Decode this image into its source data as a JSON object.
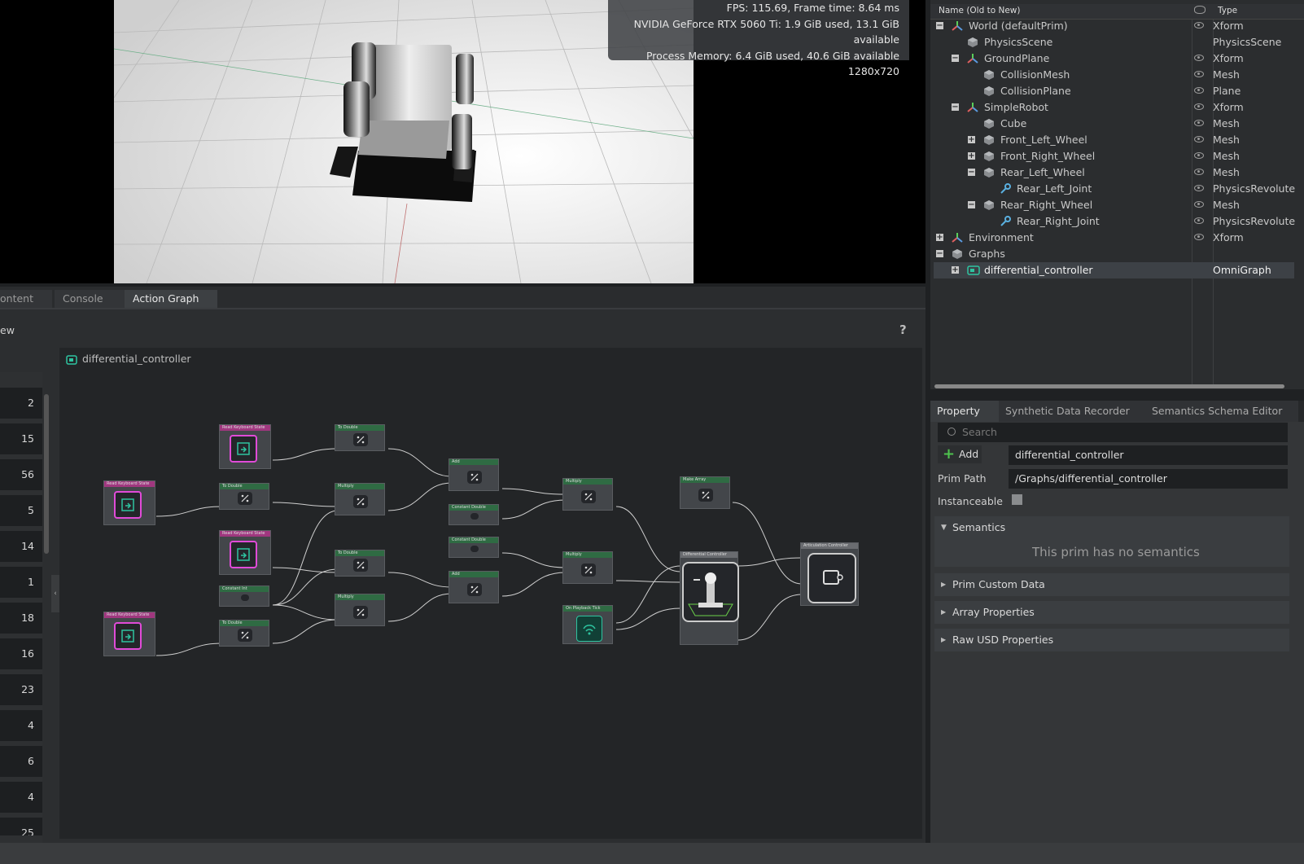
{
  "viewport": {
    "stats": [
      "FPS: 115.69, Frame time: 8.64 ms",
      "NVIDIA GeForce RTX 5060 Ti: 1.9 GiB used, 13.1 GiB available",
      "Process Memory: 6.4 GiB used, 40.6 GiB available",
      "1280x720"
    ]
  },
  "bottom_tabs": [
    "ontent",
    "Console",
    "Action Graph"
  ],
  "action_graph": {
    "header_left": "ew",
    "help_icon": "?",
    "graph_title": "differential_controller",
    "left_numbers": [
      "2",
      "15",
      "56",
      "5",
      "14",
      "1",
      "18",
      "16",
      "23",
      "4",
      "6",
      "4",
      "25"
    ],
    "nodes": {
      "read_keyboard": "Read Keyboard State",
      "to_double": "To Double",
      "multiply": "Multiply",
      "add": "Add",
      "constant_double": "Constant Double",
      "constant_int": "Constant Int",
      "make_array": "Make Array",
      "on_playback_tick": "On Playback Tick",
      "differential_controller": "Differential Controller",
      "articulation_controller": "Articulation Controller"
    }
  },
  "stage": {
    "col_name": "Name (Old to New)",
    "col_type": "Type",
    "rows": [
      {
        "name": "World (defaultPrim)",
        "type": "Xform"
      },
      {
        "name": "PhysicsScene",
        "type": "PhysicsScene"
      },
      {
        "name": "GroundPlane",
        "type": "Xform"
      },
      {
        "name": "CollisionMesh",
        "type": "Mesh"
      },
      {
        "name": "CollisionPlane",
        "type": "Plane"
      },
      {
        "name": "SimpleRobot",
        "type": "Xform"
      },
      {
        "name": "Cube",
        "type": "Mesh"
      },
      {
        "name": "Front_Left_Wheel",
        "type": "Mesh"
      },
      {
        "name": "Front_Right_Wheel",
        "type": "Mesh"
      },
      {
        "name": "Rear_Left_Wheel",
        "type": "Mesh"
      },
      {
        "name": "Rear_Left_Joint",
        "type": "PhysicsRevolute"
      },
      {
        "name": "Rear_Right_Wheel",
        "type": "Mesh"
      },
      {
        "name": "Rear_Right_Joint",
        "type": "PhysicsRevolute"
      },
      {
        "name": "Environment",
        "type": "Xform"
      },
      {
        "name": "Graphs",
        "type": ""
      },
      {
        "name": "differential_controller",
        "type": "OmniGraph"
      }
    ]
  },
  "property": {
    "tabs": [
      "Property",
      "Synthetic Data Recorder",
      "Semantics Schema Editor"
    ],
    "search_placeholder": "Search",
    "add_label": "Add",
    "name_value": "differential_controller",
    "prim_path_label": "Prim Path",
    "prim_path_value": "/Graphs/differential_controller",
    "instanceable_label": "Instanceable",
    "semantics_label": "Semantics",
    "no_semantics": "This prim has no semantics",
    "sections": [
      "Prim Custom Data",
      "Array Properties",
      "Raw USD Properties"
    ]
  },
  "colors": {
    "keyboard_header": "#a0377f",
    "math_header": "#2f6b43",
    "accent_pink": "#e04bd8",
    "accent_teal": "#2ec4a0"
  }
}
